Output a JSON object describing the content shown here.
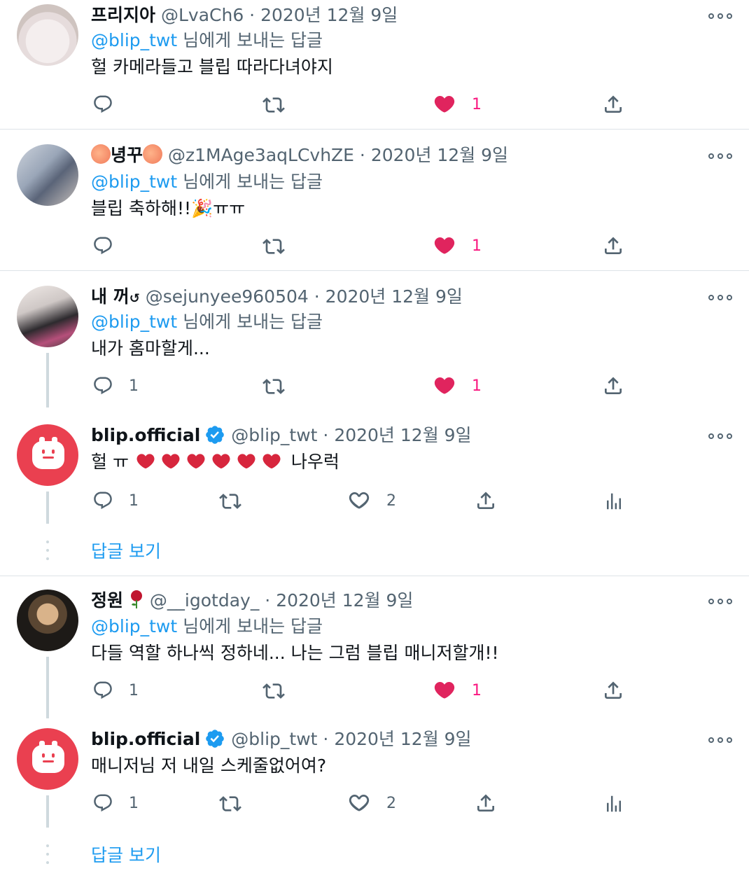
{
  "colors": {
    "accent": "#1d9bf0",
    "like": "#f91880",
    "heart_red": "#e0245e",
    "muted": "#536471",
    "blip": "#ea4050"
  },
  "tweets": [
    {
      "name": "프리지아",
      "handle": "@LvaCh6",
      "date": "2020년 12월 9일",
      "reply_mention": "@blip_twt",
      "reply_suffix": "님에게 보내는 답글",
      "text": "헐 카메라들고 블립 따라다녀야지",
      "replies": "",
      "likes": "1"
    },
    {
      "name": "녕꾸",
      "handle": "@z1MAge3aqLCvhZE",
      "date": "2020년 12월 9일",
      "reply_mention": "@blip_twt",
      "reply_suffix": "님에게 보내는 답글",
      "text": "블립 축하해!!🎉ㅠㅠ",
      "replies": "",
      "likes": "1"
    },
    {
      "name": "내 꺼",
      "name_suffix": "↺",
      "handle": "@sejunyee960504",
      "date": "2020년 12월 9일",
      "reply_mention": "@blip_twt",
      "reply_suffix": "님에게 보내는 답글",
      "text": "내가 홈마할게...",
      "replies": "1",
      "likes": "1"
    },
    {
      "name": "blip.official",
      "handle": "@blip_twt",
      "date": "2020년 12월 9일",
      "text_pre": "헐 ㅠ",
      "text_post": "나우럭",
      "replies": "1",
      "likes": "2",
      "show_replies": "답글 보기"
    },
    {
      "name": "정원",
      "handle": "@__igotday_",
      "date": "2020년 12월 9일",
      "reply_mention": "@blip_twt",
      "reply_suffix": "님에게 보내는 답글",
      "text": "다들 역할 하나씩 정하네... 나는 그럼 블립 매니저할개!!",
      "replies": "1",
      "likes": "1"
    },
    {
      "name": "blip.official",
      "handle": "@blip_twt",
      "date": "2020년 12월 9일",
      "text": "매니저님 저 내일 스케줄없어여?",
      "replies": "1",
      "likes": "2",
      "show_replies": "답글 보기"
    }
  ]
}
